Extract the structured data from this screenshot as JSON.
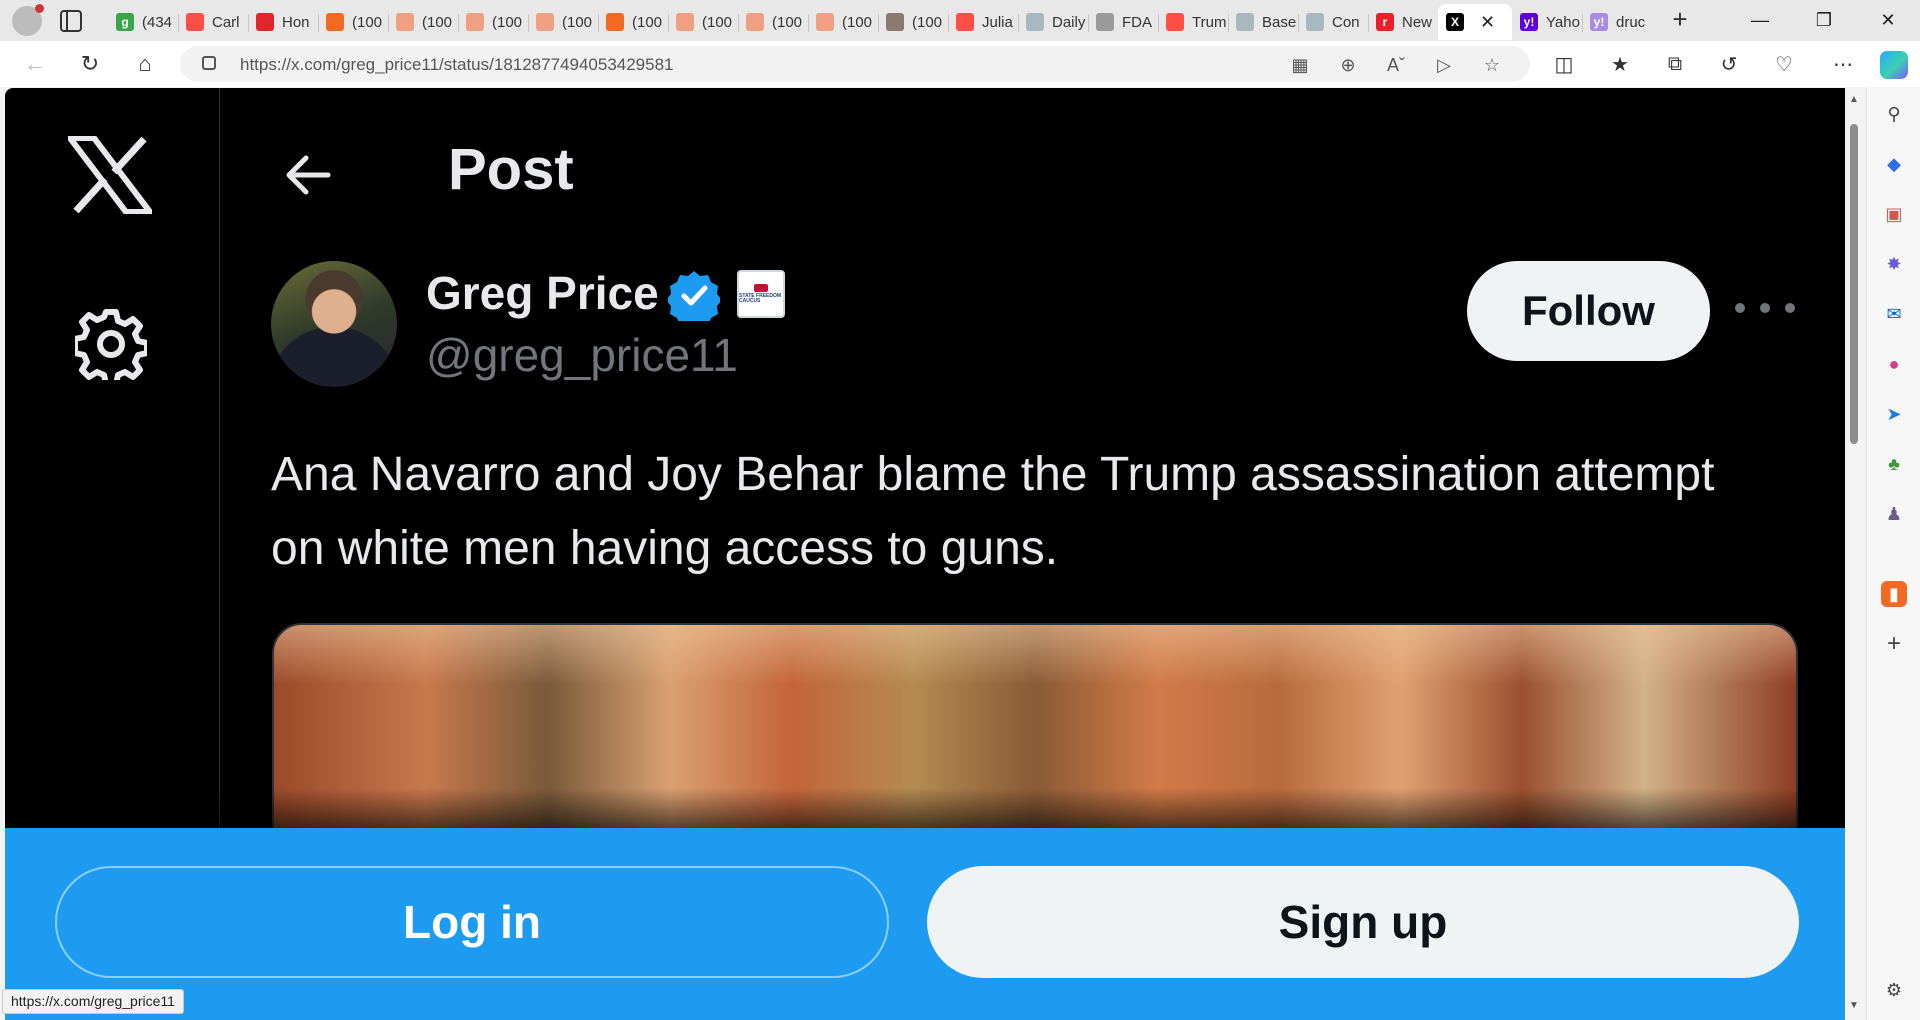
{
  "browser": {
    "tabs": [
      {
        "title": "(434",
        "favicon": "g",
        "color": "#3aa64a"
      },
      {
        "title": "Carl",
        "favicon": "youtube-icon",
        "color": "#ff4e45"
      },
      {
        "title": "Hon",
        "favicon": "pin-icon",
        "color": "#e0262b"
      },
      {
        "title": "(100",
        "favicon": "bookmark-icon",
        "color": "#f26a21"
      },
      {
        "title": "(100",
        "favicon": "bookmark-icon",
        "color": "#f0a080"
      },
      {
        "title": "(100",
        "favicon": "bookmark-icon",
        "color": "#f0a080"
      },
      {
        "title": "(100",
        "favicon": "bookmark-icon",
        "color": "#f0a080"
      },
      {
        "title": "(100",
        "favicon": "bookmark-icon",
        "color": "#f26a21"
      },
      {
        "title": "(100",
        "favicon": "bookmark-icon",
        "color": "#f0a080"
      },
      {
        "title": "(100",
        "favicon": "bookmark-icon",
        "color": "#f0a080"
      },
      {
        "title": "(100",
        "favicon": "bookmark-icon",
        "color": "#f0a080"
      },
      {
        "title": "(100",
        "favicon": "thumbnail-icon",
        "color": "#8a7a70"
      },
      {
        "title": "Julia",
        "favicon": "youtube-icon",
        "color": "#ff4e45"
      },
      {
        "title": "Daily",
        "favicon": "shield-icon",
        "color": "#a8b8c0"
      },
      {
        "title": "FDA",
        "favicon": "document-icon",
        "color": "#9a9a9a"
      },
      {
        "title": "Trum",
        "favicon": "youtube-icon",
        "color": "#ff4e45"
      },
      {
        "title": "Base",
        "favicon": "shield-icon",
        "color": "#a8b8c0"
      },
      {
        "title": "Con",
        "favicon": "shield-icon",
        "color": "#a8b8c0"
      },
      {
        "title": "New",
        "favicon": "r",
        "color": "#e8202a"
      },
      {
        "title": "",
        "favicon": "X",
        "color": "#000000",
        "active": true
      },
      {
        "title": "Yaho",
        "favicon": "y!",
        "color": "#6001d2"
      },
      {
        "title": "druc",
        "favicon": "y!",
        "color": "#a98be6"
      }
    ],
    "url": "https://x.com/greg_price11/status/1812877494053429581",
    "status_bar_url": "https://x.com/greg_price11"
  },
  "page": {
    "header_title": "Post",
    "author": {
      "name": "Greg Price",
      "handle": "@greg_price11",
      "verified": true,
      "affiliation_badge": "STATE FREEDOM CAUCUS"
    },
    "follow_label": "Follow",
    "tweet_text": "Ana Navarro and Joy Behar blame the Trump assassination attempt on white men having access to guns.",
    "login_label": "Log in",
    "signup_label": "Sign up"
  },
  "colors": {
    "accent": "#1d9bf0",
    "background": "#000000",
    "text_primary": "#e7e9ea",
    "text_secondary": "#71767b"
  }
}
